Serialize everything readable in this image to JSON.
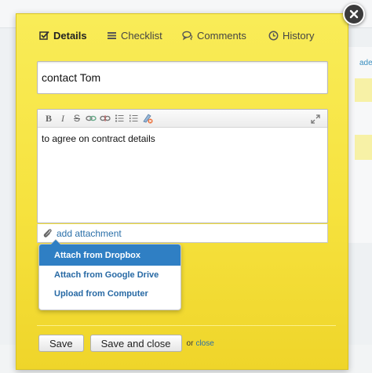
{
  "tabs": [
    {
      "label": "Details",
      "icon": "checkbox-icon",
      "active": true
    },
    {
      "label": "Checklist",
      "icon": "list-icon",
      "active": false
    },
    {
      "label": "Comments",
      "icon": "comment-icon",
      "active": false
    },
    {
      "label": "History",
      "icon": "clock-icon",
      "active": false
    }
  ],
  "task": {
    "title_value": "contact Tom",
    "description": "to agree on contract details"
  },
  "editor": {
    "toolbar_icons": [
      "bold-icon",
      "italic-icon",
      "strikethrough-icon",
      "link-icon",
      "unlink-icon",
      "bullet-list-icon",
      "numbered-list-icon",
      "clear-format-icon",
      "expand-icon"
    ],
    "bold_glyph": "B",
    "italic_glyph": "I",
    "strike_glyph": "S"
  },
  "attachment": {
    "label": "add attachment",
    "menu": [
      {
        "label": "Attach from Dropbox",
        "selected": true
      },
      {
        "label": "Attach from Google Drive",
        "selected": false
      },
      {
        "label": "Upload from Computer",
        "selected": false
      }
    ]
  },
  "footer": {
    "save_label": "Save",
    "save_close_label": "Save and close",
    "or_text": "or",
    "close_label": "close"
  },
  "background": {
    "right_link_text": "ade"
  },
  "colors": {
    "modal_yellow": "#f6e23e",
    "link_blue": "#2a6fa8",
    "menu_selected": "#2f7fc4"
  }
}
